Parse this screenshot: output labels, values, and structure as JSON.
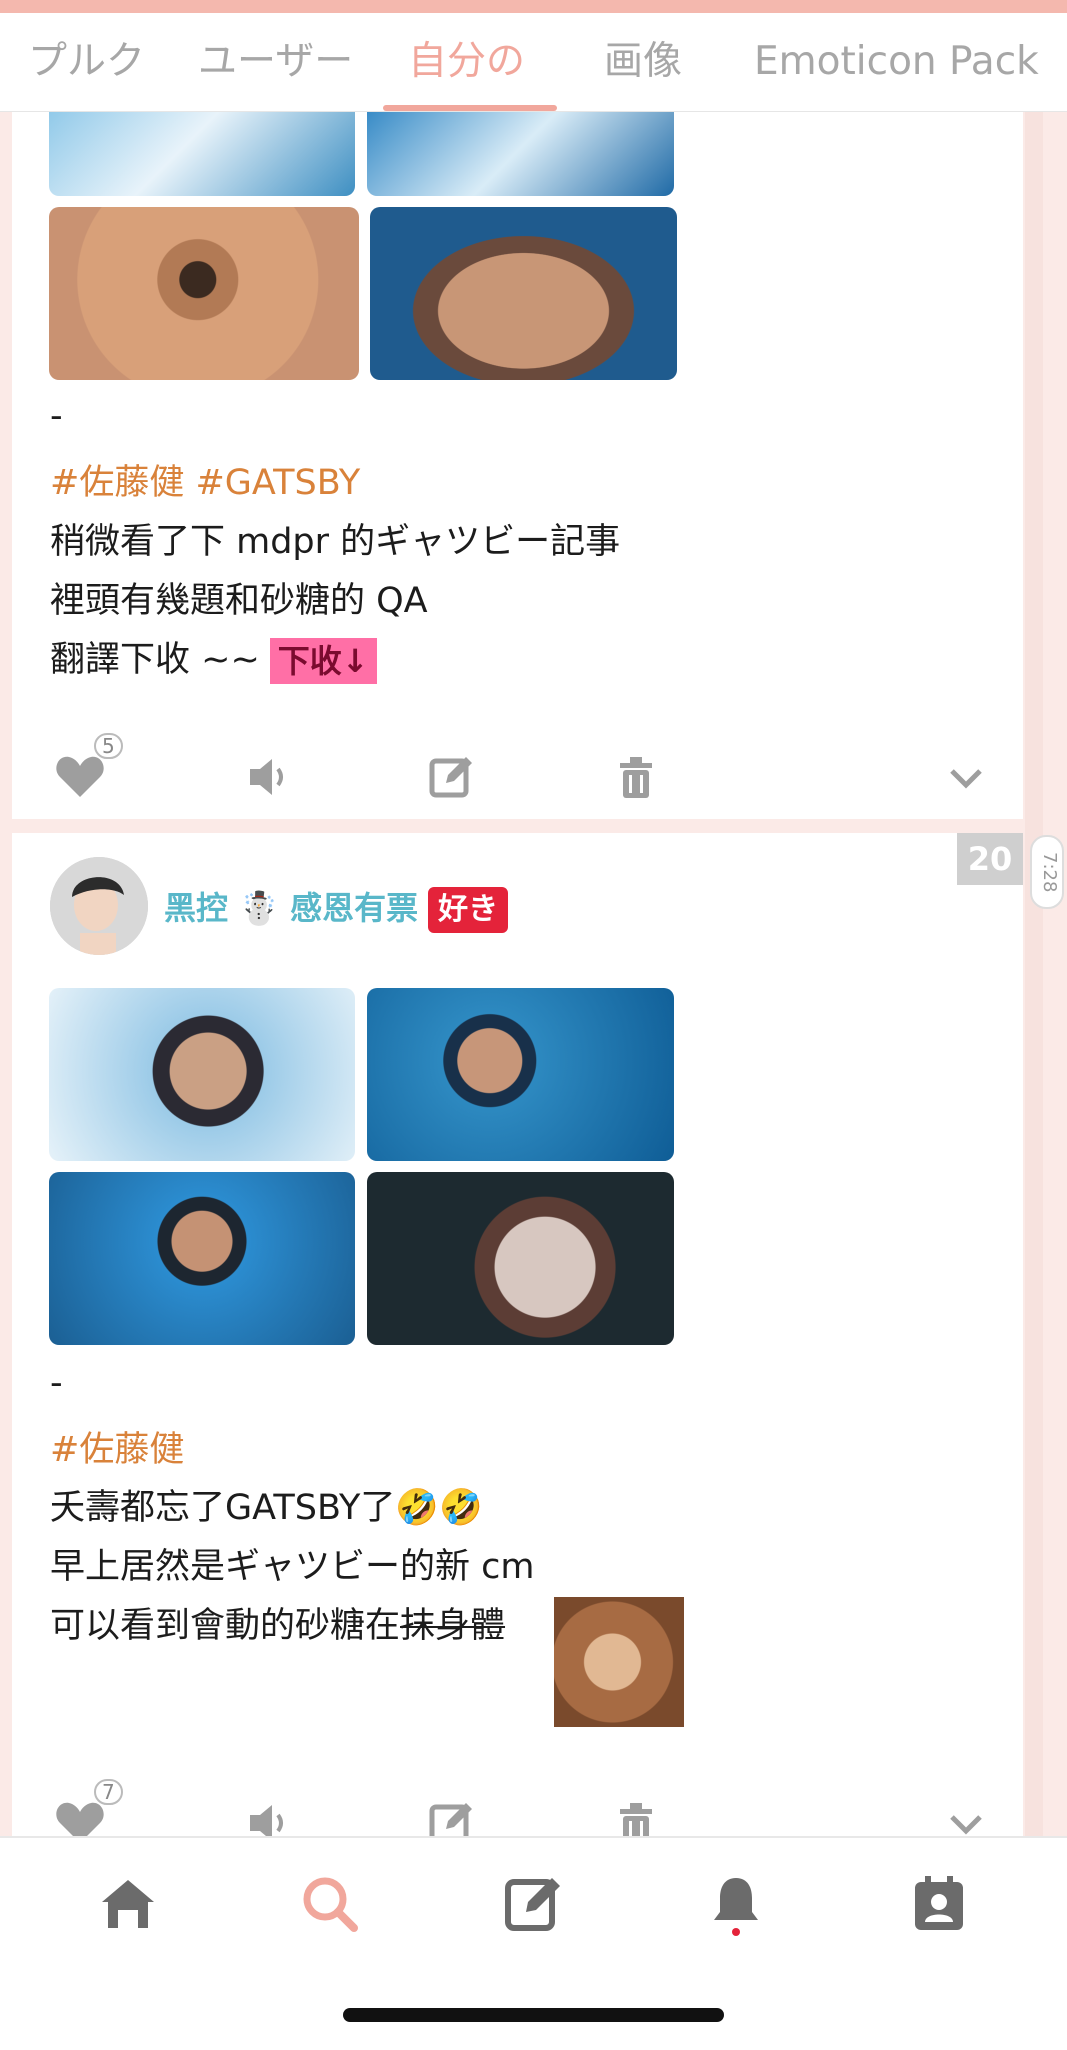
{
  "tabs": [
    "プルク",
    "ユーザー",
    "自分の",
    "画像",
    "Emoticon Pack"
  ],
  "active_tab": "自分の",
  "post1": {
    "divider": "-",
    "tags": "#佐藤健 #GATSBY",
    "lines": [
      "稍微看了下 mdpr 的ギャツビー記事",
      "裡頭有幾題和砂糖的 QA",
      "翻譯下收 ~~"
    ],
    "highlight": "下收↓",
    "like_count": "5"
  },
  "post2": {
    "username": "黑控 ☃️ 感恩有票",
    "badge": "好き",
    "number_badge": "20",
    "time": "7:28",
    "divider": "-",
    "tags": "#佐藤健",
    "line1": "夭壽都忘了GATSBY了🤣🤣",
    "line2": "早上居然是ギャツビー的新 cm",
    "line3_plain": "可以看到會動的砂糖在",
    "line3_strike": "抹身體",
    "like_count": "7"
  },
  "colors": {
    "accent": "#f1a79c",
    "tag": "#d9823a",
    "username": "#59b7c9",
    "badge_red": "#e4233a",
    "highlight_pink": "#ff6fa6"
  },
  "icons": {
    "actions": [
      "heart-icon",
      "speaker-icon",
      "edit-icon",
      "trash-icon",
      "chevron-down-icon"
    ],
    "nav": [
      "home-icon",
      "search-icon",
      "compose-icon",
      "bell-icon",
      "contacts-icon"
    ]
  }
}
